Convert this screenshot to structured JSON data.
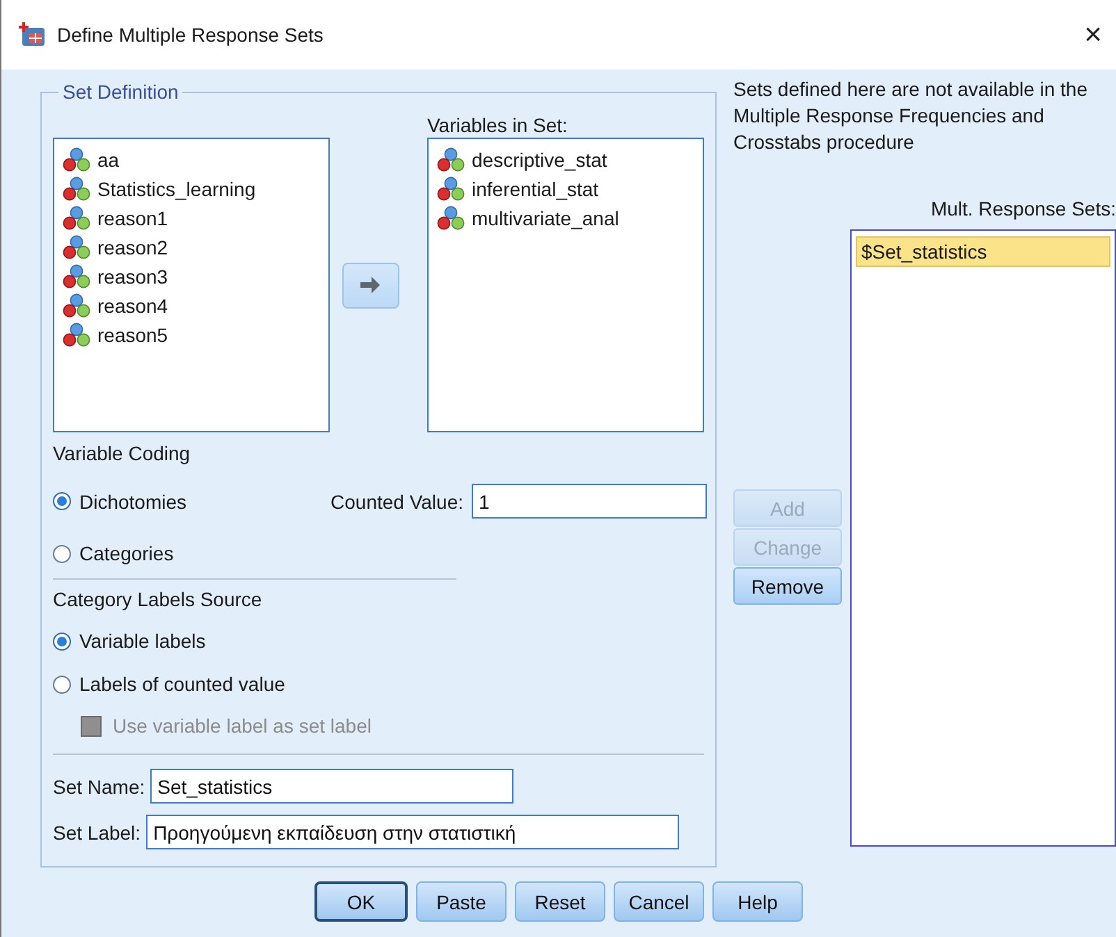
{
  "window": {
    "title": "Define Multiple Response Sets",
    "close": "×"
  },
  "set_definition": {
    "title": "Set Definition",
    "source_variables": [
      {
        "name": "aa"
      },
      {
        "name": "Statistics_learning"
      },
      {
        "name": "reason1"
      },
      {
        "name": "reason2"
      },
      {
        "name": "reason3"
      },
      {
        "name": "reason4"
      },
      {
        "name": "reason5"
      }
    ],
    "variables_in_set": {
      "label": "Variables in Set:",
      "items": [
        {
          "name": "descriptive_stat"
        },
        {
          "name": "inferential_stat"
        },
        {
          "name": "multivariate_anal"
        }
      ]
    },
    "variable_coding": {
      "title": "Variable Coding",
      "options": [
        {
          "label": "Dichotomies",
          "selected": true
        },
        {
          "label": "Categories",
          "selected": false
        }
      ],
      "counted_value": {
        "label": "Counted Value:",
        "value": "1"
      }
    },
    "category_labels_source": {
      "title": "Category Labels Source",
      "options": [
        {
          "label": "Variable labels",
          "selected": true
        },
        {
          "label": "Labels of counted value",
          "selected": false
        }
      ],
      "use_variable_label": {
        "label": "Use variable label as set label",
        "checked": false,
        "disabled": true
      }
    },
    "set_name": {
      "label": "Set Name:",
      "value": "Set_statistics"
    },
    "set_label": {
      "label": "Set Label:",
      "value": "Προηγούμενη εκπαίδευση στην στατιστική"
    }
  },
  "note": "Sets defined here are not available in the Multiple Response Frequencies and Crosstabs procedure",
  "mult_response_sets": {
    "label": "Mult. Response Sets:",
    "items": [
      {
        "name": "$Set_statistics",
        "selected": true
      }
    ]
  },
  "set_buttons": [
    {
      "label": "Add",
      "disabled": true
    },
    {
      "label": "Change",
      "disabled": true
    },
    {
      "label": "Remove",
      "disabled": false
    }
  ],
  "buttons": [
    {
      "label": "OK",
      "default": true
    },
    {
      "label": "Paste",
      "default": false
    },
    {
      "label": "Reset",
      "default": false
    },
    {
      "label": "Cancel",
      "default": false
    },
    {
      "label": "Help",
      "default": false
    }
  ]
}
